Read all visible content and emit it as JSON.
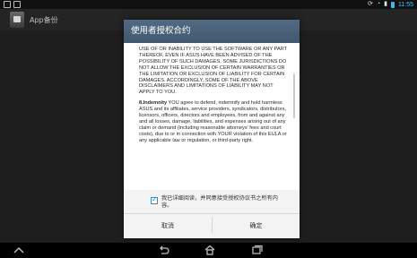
{
  "status_bar": {
    "time": "11:55"
  },
  "app_bar": {
    "title": "App备份"
  },
  "dialog": {
    "title": "使用者授权合约",
    "paragraph1": "USE OF OR INABILITY TO USE THE SOFTWARE OR ANY PART THEREOF, EVEN IF ASUS HAVE BEEN ADVISED OF THE POSSIBILITY OF SUCH DAMAGES. SOME JURISDICTIONS DO NOT ALLOW THE EXCLUSION OF CERTAIN WARRANTIES OR THE LIMITATION OR EXCLUSION OF LIABILITY FOR CERTAIN DAMAGES. ACCORDINGLY, SOME OF THE ABOVE DISCLAIMERS AND LIMITATIONS OF LIABILITY MAY NOT APPLY TO YOU.",
    "section_heading": "8.Indemnity",
    "paragraph2": " YOU agree to defend, indemnify and hold harmless ASUS and its affiliates, service providers, syndicators, distributors, licensors, officers, directors and employees, from and against any and all losses, damage, liabilities, and expenses arising out of any claim or demand (including reasonable attorneys' fees and court costs), due to or in connection with YOUR violation of this EULA or any applicable law or regulation, or third-party right.",
    "consent_text": "我已详细阅读，并同意接受授权协议书之所有内容。",
    "consent_checked": true,
    "cancel_label": "取消",
    "ok_label": "确定"
  },
  "colors": {
    "title_bar": "#4b6379",
    "accent": "#2e87c8"
  }
}
